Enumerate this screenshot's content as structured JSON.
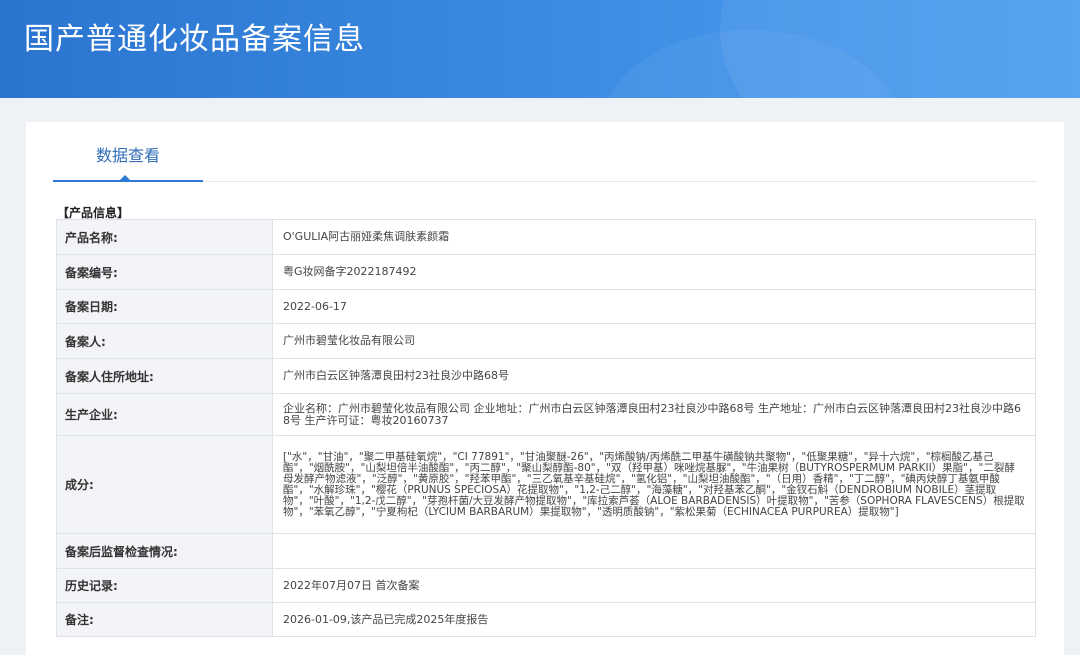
{
  "header": {
    "title": "国产普通化妆品备案信息"
  },
  "tabs": [
    {
      "label": "数据查看"
    }
  ],
  "section": {
    "title": "【产品信息】"
  },
  "rows": [
    {
      "label": "产品名称:",
      "value": "O'GULIA阿古丽娅柔焦调肤素颜霜"
    },
    {
      "label": "备案编号:",
      "value": "粤G妆网备字2022187492"
    },
    {
      "label": "备案日期:",
      "value": "2022-06-17"
    },
    {
      "label": "备案人:",
      "value": "广州市碧莹化妆品有限公司"
    },
    {
      "label": "备案人住所地址:",
      "value": "广州市白云区钟落潭良田村23社良沙中路68号"
    },
    {
      "label": "生产企业:",
      "value": "企业名称：广州市碧莹化妆品有限公司 企业地址：广州市白云区钟落潭良田村23社良沙中路68号 生产地址：广州市白云区钟落潭良田村23社良沙中路68号 生产许可证：粤妆20160737"
    },
    {
      "label": "成分:",
      "value": "[\"水\"，\"甘油\"，\"聚二甲基硅氧烷\"，\"CI 77891\"，\"甘油聚醚-26\"，\"丙烯酸钠/丙烯酰二甲基牛磺酸钠共聚物\"，\"低聚果糖\"，\"异十六烷\"，\"棕榈酸乙基己酯\"，\"烟酰胺\"，\"山梨坦倍半油酸酯\"，\"丙二醇\"，\"聚山梨醇酯-80\"，\"双（羟甲基）咪唑烷基脲\"，\"牛油果树（BUTYROSPERMUM PARKII）果脂\"，\"二裂酵母发酵产物滤液\"，\"泛醇\"，\"黄原胶\"，\"羟苯甲酯\"，\"三乙氧基辛基硅烷\"，\"氢化铝\"，\"山梨坦油酸酯\"，\"（日用）香精\"，\"丁二醇\"，\"碘丙炔醇丁基氨甲酸酯\"，\"水解珍珠\"，\"樱花（PRUNUS SPECIOSA）花提取物\"，\"1,2-己二醇\"，\"海藻糖\"，\"对羟基苯乙酮\"，\"金钗石斛（DENDROBIUM NOBILE）茎提取物\"，\"叶酸\"，\"1,2-戊二醇\"，\"芽孢杆菌/大豆发酵产物提取物\"，\"库拉索芦荟（ALOE BARBADENSIS）叶提取物\"，\"苦参（SOPHORA FLAVESCENS）根提取物\"，\"苯氧乙醇\"，\"宁夏枸杞（LYCIUM BARBARUM）果提取物\"，\"透明质酸钠\"，\"紫松果菊（ECHINACEA PURPUREA）提取物\"]"
    },
    {
      "label": "备案后监督检查情况:",
      "value": ""
    },
    {
      "label": "历史记录:",
      "value": "2022年07月07日 首次备案"
    },
    {
      "label": "备注:",
      "value": "2026-01-09,该产品已完成2025年度报告"
    }
  ]
}
